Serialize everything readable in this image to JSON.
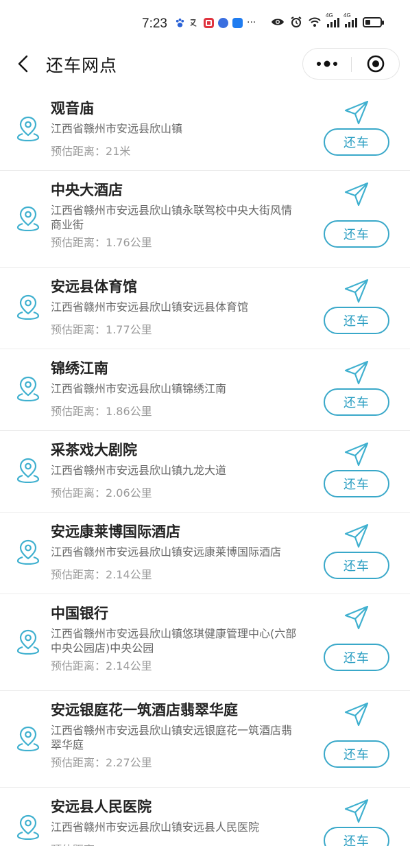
{
  "status_bar": {
    "time": "7:23",
    "icons": [
      "paw-icon",
      "translate-icon",
      "red-square-app-icon",
      "blue-circle-app-icon",
      "blue-square-app-icon",
      "more-dots"
    ],
    "more": "···",
    "signal_tag_1": "4G",
    "signal_tag_2": "4G",
    "battery_level": 0.35
  },
  "nav": {
    "title": "还车网点",
    "more_icon": "more-dots-icon",
    "close_icon": "target-circle-icon"
  },
  "colors": {
    "accent": "#2b9ec2",
    "pin": "#3fb0cf",
    "name": "#222222",
    "address": "#666666",
    "distance": "#999999"
  },
  "stations": [
    {
      "name": "观音庙",
      "address": "江西省赣州市安远县欣山镇",
      "distance_label": "预估距离：",
      "distance": "21米",
      "button": "还车"
    },
    {
      "name": "中央大酒店",
      "address": "江西省赣州市安远县欣山镇永联驾校中央大街风情商业街",
      "distance_label": "预估距离：",
      "distance": "1.76公里",
      "button": "还车"
    },
    {
      "name": "安远县体育馆",
      "address": "江西省赣州市安远县欣山镇安远县体育馆",
      "distance_label": "预估距离：",
      "distance": "1.77公里",
      "button": "还车"
    },
    {
      "name": "锦绣江南",
      "address": "江西省赣州市安远县欣山镇锦绣江南",
      "distance_label": "预估距离：",
      "distance": "1.86公里",
      "button": "还车"
    },
    {
      "name": "采茶戏大剧院",
      "address": "江西省赣州市安远县欣山镇九龙大道",
      "distance_label": "预估距离：",
      "distance": "2.06公里",
      "button": "还车"
    },
    {
      "name": "安远康莱博国际酒店",
      "address": "江西省赣州市安远县欣山镇安远康莱博国际酒店",
      "distance_label": "预估距离：",
      "distance": "2.14公里",
      "button": "还车"
    },
    {
      "name": "中国银行",
      "address": "江西省赣州市安远县欣山镇悠琪健康管理中心(六部中央公园店)中央公园",
      "distance_label": "预估距离：",
      "distance": "2.14公里",
      "button": "还车"
    },
    {
      "name": "安远银庭花一筑酒店翡翠华庭",
      "address": "江西省赣州市安远县欣山镇安远银庭花一筑酒店翡翠华庭",
      "distance_label": "预估距离：",
      "distance": "2.27公里",
      "button": "还车"
    },
    {
      "name": "安远县人民医院",
      "address": "江西省赣州市安远县欣山镇安远县人民医院",
      "distance_label": "预估距离：",
      "distance": "",
      "button": "还车"
    }
  ]
}
